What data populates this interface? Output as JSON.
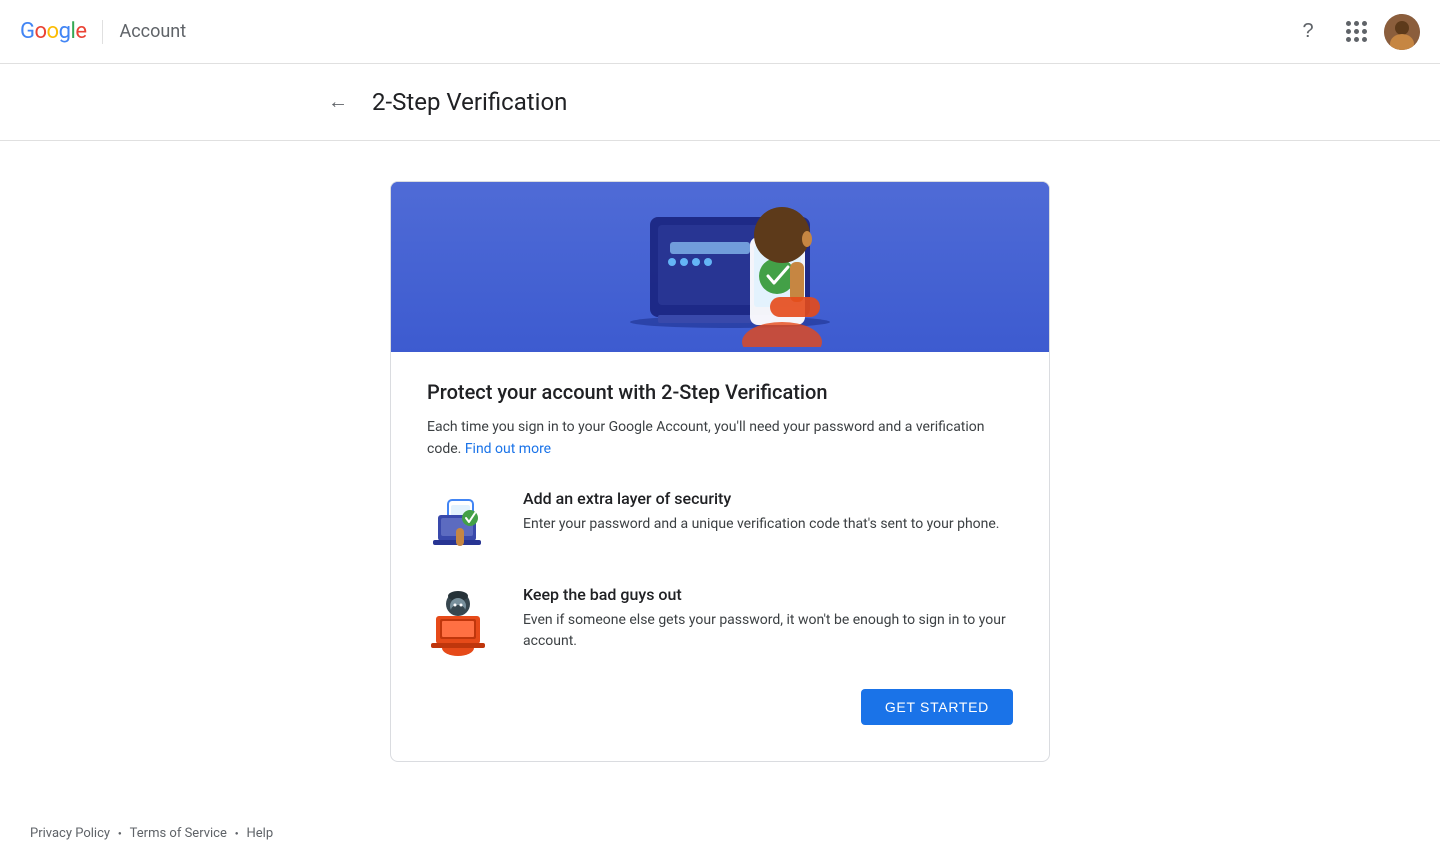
{
  "header": {
    "logo_text_g": "G",
    "logo_text_o1": "o",
    "logo_text_o2": "o",
    "logo_text_g2": "g",
    "logo_text_l": "l",
    "logo_text_e": "e",
    "product_name": "Account"
  },
  "page": {
    "title": "2-Step Verification",
    "back_label": "←"
  },
  "card": {
    "heading": "Protect your account with 2-Step Verification",
    "description_part1": "Each time you sign in to your Google Account, you'll need your password and a verification code.",
    "find_out_more": "Find out more",
    "features": [
      {
        "title": "Add an extra layer of security",
        "description": "Enter your password and a unique verification code that's sent to your phone."
      },
      {
        "title": "Keep the bad guys out",
        "description": "Even if someone else gets your password, it won't be enough to sign in to your account."
      }
    ],
    "cta_label": "GET STARTED"
  },
  "footer": {
    "privacy_label": "Privacy Policy",
    "terms_label": "Terms of Service",
    "help_label": "Help"
  }
}
